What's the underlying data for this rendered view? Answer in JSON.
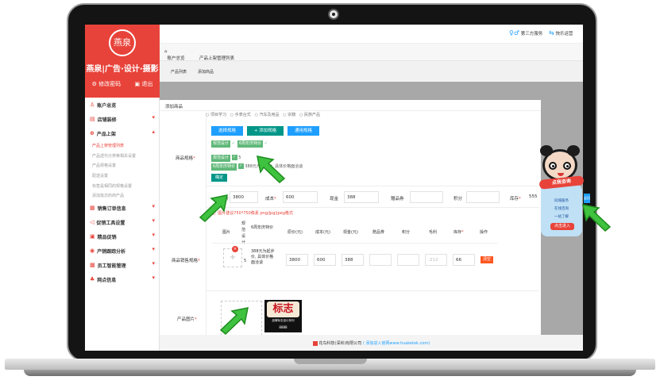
{
  "brand": {
    "logo_text": "燕泉",
    "title": "燕泉|广告·设计·摄影",
    "change_password": "修改密码",
    "logout": "退出"
  },
  "nav": {
    "account": "账户总览",
    "store": "店铺装修",
    "products": "产品上架",
    "product_subitems": [
      "产品上架管理列表",
      "产品送代分类等相关设置",
      "产品规格设置",
      "配送设置",
      "标签是相同的规格设置",
      "添加批次的商产品"
    ],
    "sales_orders": "销售订单信息",
    "promo_tools": "促销工具设置",
    "coupons": "精品促销",
    "analytics": "产销跟踪分析",
    "staff": "员工智能管理",
    "branch": "网点信息"
  },
  "topbar": {
    "third_party": "第三方服务",
    "more_services": "快乐运营"
  },
  "tabs": {
    "home": "账户总览",
    "current": "产品上架管理列表",
    "close": "×"
  },
  "subtabs": {
    "list": "产品列表",
    "add": "添加商品"
  },
  "content": {
    "header": "添加商品",
    "radio_options": [
      "项目学习",
      "手表台式",
      "汽车及用品",
      "宗籍",
      "民族产品"
    ],
    "spec_label": "商品规格",
    "btn_select_spec": "选择规格",
    "btn_add_spec": "+ 添加规格",
    "btn_common_spec": "通用规格",
    "tag_spec_design": "规范设计",
    "tag_spec_year": "6周年庆特价",
    "spec_row1_tag": "规范设计",
    "spec_row1_value": "5",
    "spec_row2_tag": "6周年庆特价",
    "spec_row2_value": "388元为起步价, 具体价格面洽谈",
    "confirm": "确定",
    "price_fields": {
      "original_label": "原价",
      "original_value": "3800",
      "cost_label": "成本",
      "cost_value": "600",
      "cash_label": "现金",
      "cash_value": "388",
      "coupon_label": "赠品券",
      "coupon_value": "",
      "points_label": "积分",
      "points_value": "",
      "stock_label": "库存",
      "stock_value": "555",
      "fill_btn": "填充"
    },
    "sales_spec_label": "商品销售规格",
    "image_note": "注: 图片建议750*750像素.png/jpg/jpeg格式",
    "table_headers": [
      "图片",
      "规范设计",
      "6周年庆特价",
      "原价(元)",
      "成本(元)",
      "现金(元)",
      "赠品券",
      "积分",
      "毛利",
      "库存",
      "操作"
    ],
    "table_row": {
      "spec": "5",
      "promo": "388元为起步价, 具体价格面洽谈",
      "original": "3800",
      "cost": "600",
      "cash": "388",
      "coupon": "",
      "points": "",
      "profit": "-212",
      "stock": "66",
      "action": "清空"
    },
    "product_image_label": "产品图片",
    "product_image_text": "标志",
    "product_image_sub": "品牌标志设计系列",
    "product_image_sub2": "8888"
  },
  "footer": {
    "company": "花鸟科技(深圳)有限公司",
    "link": "( 添加进入官网www.huaketek.com)"
  },
  "mascot": {
    "banner": "点我咨询",
    "line1": "同城服务",
    "line2": "在线咨询",
    "line3": "一站了解",
    "button": "点击进入",
    "side": "返回"
  }
}
